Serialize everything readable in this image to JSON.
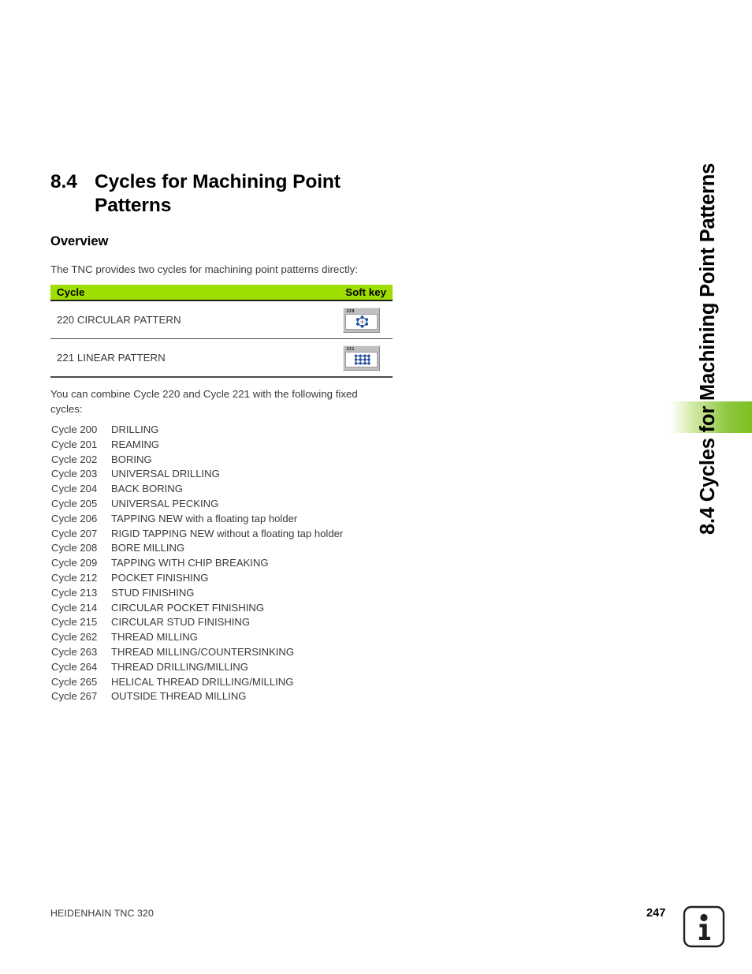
{
  "side_tab": {
    "label": "8.4 Cycles for Machining Point Patterns",
    "accent_color": "#8dc63f"
  },
  "heading": {
    "number": "8.4",
    "title": "Cycles for Machining Point Patterns"
  },
  "overview": {
    "heading": "Overview",
    "intro": "The TNC provides two cycles for machining point patterns directly:"
  },
  "softkey_table": {
    "header_color": "#9ede00",
    "columns": {
      "cycle": "Cycle",
      "soft_key": "Soft key"
    },
    "rows": [
      {
        "name": "220 CIRCULAR PATTERN",
        "key_number": "220",
        "icon": "circular-pattern-icon"
      },
      {
        "name": "221 LINEAR PATTERN",
        "key_number": "221",
        "icon": "linear-pattern-icon"
      }
    ]
  },
  "combine": {
    "text": "You can combine Cycle 220 and Cycle 221 with the following fixed cycles:"
  },
  "cycle_list": [
    {
      "id": "Cycle 200",
      "name": "DRILLING"
    },
    {
      "id": "Cycle 201",
      "name": "REAMING"
    },
    {
      "id": "Cycle 202",
      "name": "BORING"
    },
    {
      "id": "Cycle 203",
      "name": "UNIVERSAL DRILLING"
    },
    {
      "id": "Cycle 204",
      "name": "BACK BORING"
    },
    {
      "id": "Cycle 205",
      "name": "UNIVERSAL PECKING"
    },
    {
      "id": "Cycle 206",
      "name": "TAPPING NEW with a floating tap holder"
    },
    {
      "id": "Cycle 207",
      "name": "RIGID TAPPING NEW without a floating tap holder"
    },
    {
      "id": "Cycle 208",
      "name": "BORE MILLING"
    },
    {
      "id": "Cycle 209",
      "name": "TAPPING WITH CHIP BREAKING"
    },
    {
      "id": "Cycle 212",
      "name": "POCKET FINISHING"
    },
    {
      "id": "Cycle 213",
      "name": "STUD FINISHING"
    },
    {
      "id": "Cycle 214",
      "name": "CIRCULAR POCKET FINISHING"
    },
    {
      "id": "Cycle 215",
      "name": "CIRCULAR STUD FINISHING"
    },
    {
      "id": "Cycle 262",
      "name": "THREAD MILLING"
    },
    {
      "id": "Cycle 263",
      "name": "THREAD MILLING/COUNTERSINKING"
    },
    {
      "id": "Cycle 264",
      "name": "THREAD DRILLING/MILLING"
    },
    {
      "id": "Cycle 265",
      "name": "HELICAL THREAD DRILLING/MILLING"
    },
    {
      "id": "Cycle 267",
      "name": "OUTSIDE THREAD MILLING"
    }
  ],
  "footer": {
    "product": "HEIDENHAIN TNC 320",
    "page_number": "247",
    "info_icon": "information-icon"
  }
}
